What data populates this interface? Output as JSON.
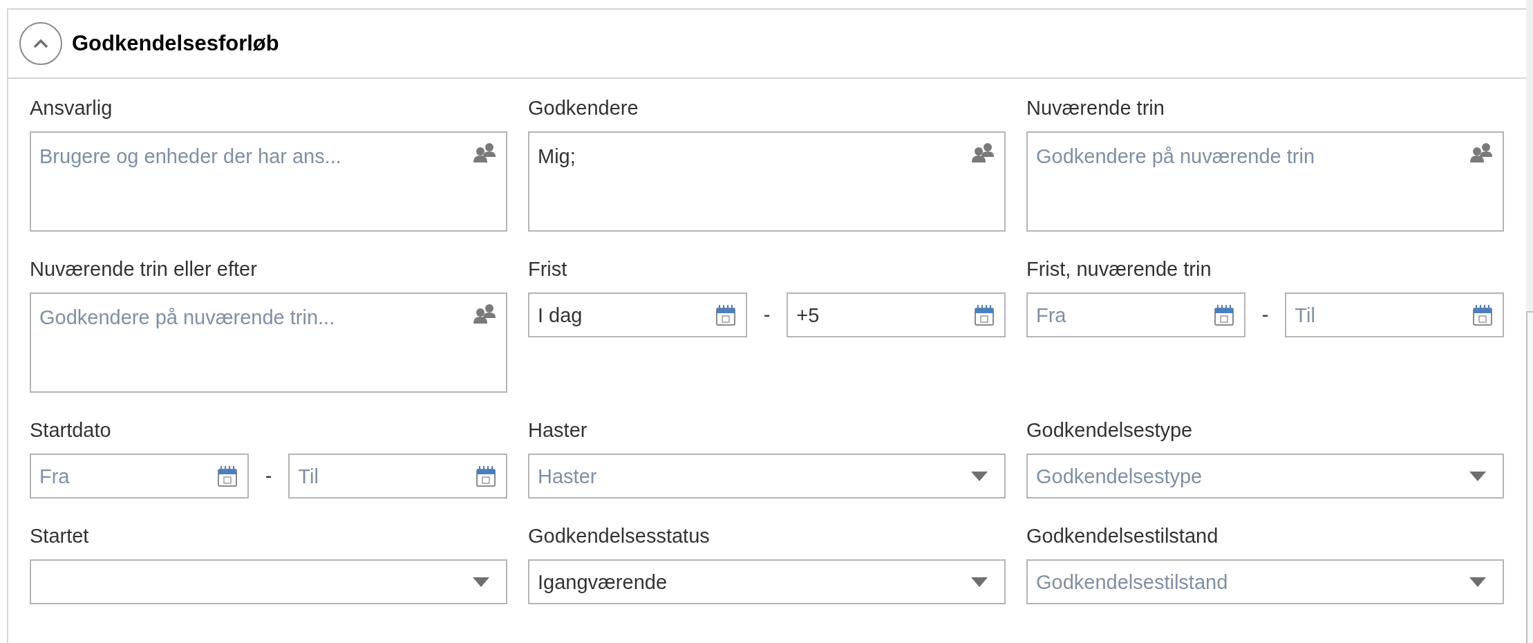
{
  "section": {
    "title": "Godkendelsesforløb",
    "expanded": true
  },
  "fields": [
    {
      "label": "Ansvarlig",
      "kind": "people",
      "placeholder": "Brugere og enheder der har ans..."
    },
    {
      "label": "Godkendere",
      "kind": "people",
      "value": "Mig;"
    },
    {
      "label": "Nuværende trin",
      "kind": "people",
      "placeholder": "Godkendere på nuværende trin"
    },
    {
      "label": "Nuværende trin eller efter",
      "kind": "people",
      "placeholder": "Godkendere på nuværende trin..."
    },
    {
      "label": "Frist",
      "kind": "date_range",
      "from": {
        "value": "I dag"
      },
      "separator": "-",
      "to": {
        "value": "+5"
      }
    },
    {
      "label": "Frist, nuværende trin",
      "kind": "date_range",
      "from": {
        "placeholder": "Fra"
      },
      "separator": "-",
      "to": {
        "placeholder": "Til"
      }
    },
    {
      "label": "Startdato",
      "kind": "date_range",
      "from": {
        "placeholder": "Fra"
      },
      "separator": "-",
      "to": {
        "placeholder": "Til"
      }
    },
    {
      "label": "Haster",
      "kind": "dropdown",
      "placeholder": "Haster"
    },
    {
      "label": "Godkendelsestype",
      "kind": "dropdown",
      "placeholder": "Godkendelsestype"
    },
    {
      "label": "Startet",
      "kind": "dropdown"
    },
    {
      "label": "Godkendelsesstatus",
      "kind": "dropdown",
      "value": "Igangværende"
    },
    {
      "label": "Godkendelsestilstand",
      "kind": "dropdown",
      "placeholder": "Godkendelsestilstand"
    }
  ]
}
